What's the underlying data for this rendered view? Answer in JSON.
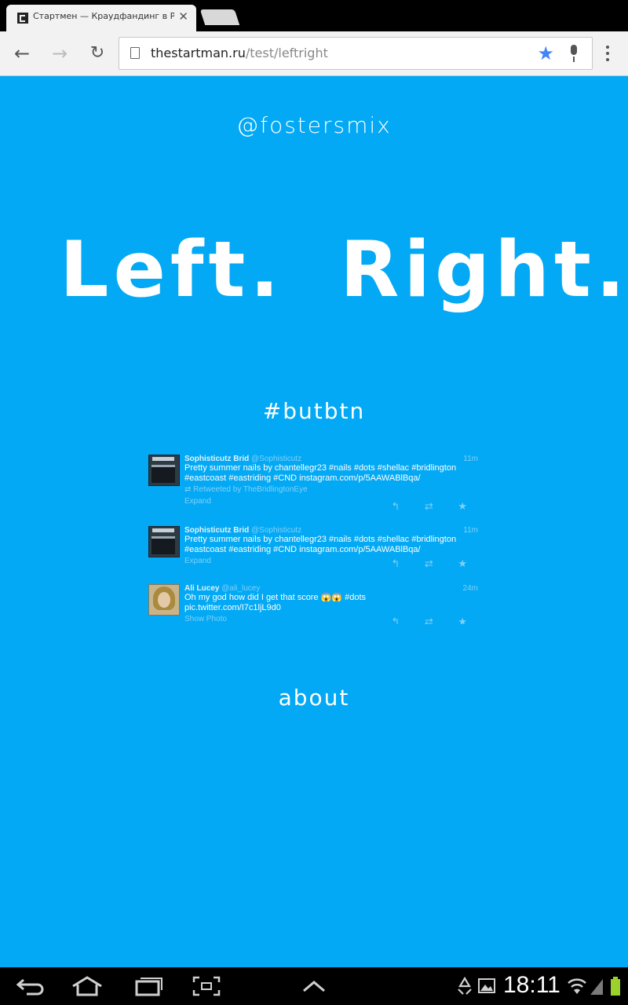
{
  "browser": {
    "tab_title": "Стартмен — Краудфандинг в Р",
    "tab_close": "✕",
    "url_domain": "thestartman.ru",
    "url_path": "/test/leftright",
    "back_icon": "←",
    "forward_icon": "→",
    "reload_icon": "↻",
    "star_icon": "★"
  },
  "page": {
    "handle": "@fostersmix",
    "left_word": "Left.",
    "right_word": "Right.",
    "hashtag": "#butbtn",
    "about_link": "about"
  },
  "tweets": [
    {
      "name": "Sophisticutz Brid",
      "screen": "@Sophisticutz",
      "time": "11m",
      "text": "Pretty summer nails by chantellegr23 #nails #dots #shellac #bridlington #eastcoast #eastriding #CND instagram.com/p/5AAWABlBqa/",
      "retweet": "Retweeted by TheBridlingtonEye",
      "expand": "Expand"
    },
    {
      "name": "Sophisticutz Brid",
      "screen": "@Sophisticutz",
      "time": "11m",
      "text": "Pretty summer nails by chantellegr23 #nails #dots #shellac #bridlington #eastcoast #eastriding #CND instagram.com/p/5AAWABlBqa/",
      "expand": "Expand"
    },
    {
      "name": "Ali Lucey",
      "screen": "@ali_lucey",
      "time": "24m",
      "text": "Oh my god how did I get that score 😱😱 #dots pic.twitter.com/I7c1ljL9d0",
      "expand": "Show Photo"
    }
  ],
  "tweet_actions": "↰ ⇄ ★",
  "system": {
    "clock": "18:11"
  },
  "colors": {
    "page_bg": "#03a9f4",
    "star": "#4285f4"
  }
}
